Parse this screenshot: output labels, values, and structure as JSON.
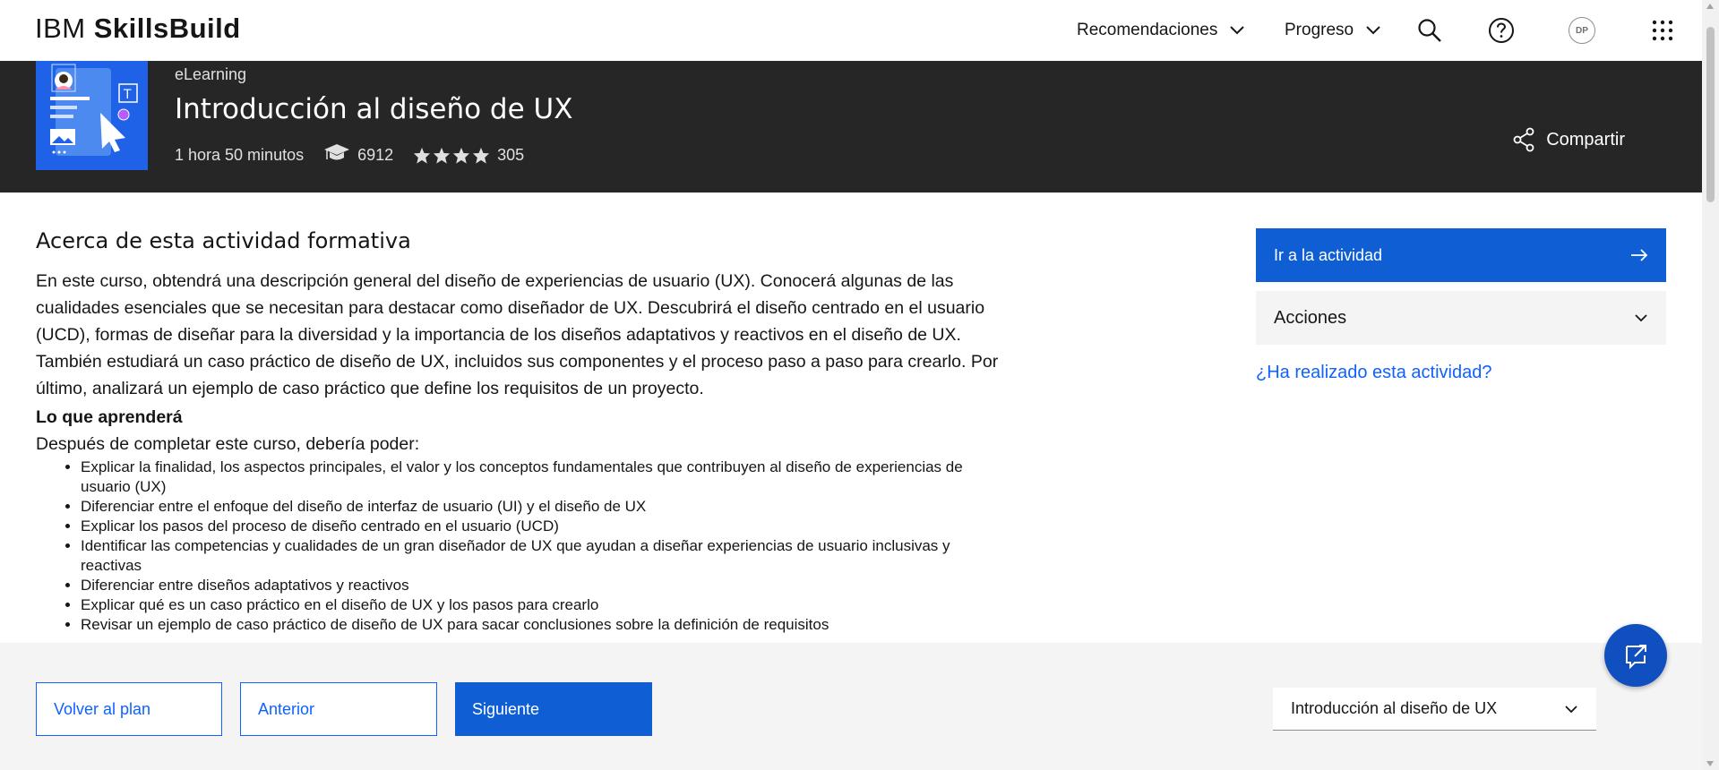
{
  "header": {
    "brand_light": "IBM ",
    "brand_bold": "SkillsBuild",
    "nav": [
      {
        "label": "Recomendaciones"
      },
      {
        "label": "Progreso"
      }
    ],
    "avatar_initials": "DP",
    "icons": [
      "search-icon",
      "help-icon",
      "app-switcher-icon"
    ]
  },
  "banner": {
    "kicker": "eLearning",
    "title": "Introducción al diseño de UX",
    "duration": "1 hora 50 minutos",
    "enrolled": "6912",
    "rating_count": "305",
    "rating_stars": 4,
    "share_label": "Compartir"
  },
  "about": {
    "title": "Acerca de esta actividad formativa",
    "description": "En este curso, obtendrá una descripción general del diseño de experiencias de usuario (UX). Conocerá algunas de las cualidades esenciales que se necesitan para destacar como diseñador de UX. Descubrirá el diseño centrado en el usuario (UCD), formas de diseñar para la diversidad y la importancia de los diseños adaptativos y reactivos en el diseño de UX. También estudiará un caso práctico de diseño de UX, incluidos sus componentes y el proceso paso a paso para crearlo. Por último, analizará un ejemplo de caso práctico que define los requisitos de un proyecto.",
    "learn_heading": "Lo que aprenderá",
    "learn_intro": "Después de completar este curso, debería poder:",
    "outcomes": [
      "Explicar la finalidad, los aspectos principales, el valor y los conceptos fundamentales que contribuyen al diseño de experiencias de usuario (UX)",
      "Diferenciar entre el enfoque del diseño de interfaz de usuario (UI) y el diseño de UX",
      "Explicar los pasos del proceso de diseño centrado en el usuario (UCD)",
      "Identificar las competencias y cualidades de un gran diseñador de UX que ayudan a diseñar experiencias de usuario inclusivas y reactivas",
      "Diferenciar entre diseños adaptativos y reactivos",
      "Explicar qué es un caso práctico en el diseño de UX y los pasos para crearlo",
      "Revisar un ejemplo de caso práctico de diseño de UX para sacar conclusiones sobre la definición de requisitos"
    ]
  },
  "sidebar": {
    "go_label": "Ir a la actividad",
    "actions_label": "Acciones",
    "done_link": "¿Ha realizado esta actividad?"
  },
  "footer": {
    "back_label": "Volver al plan",
    "prev_label": "Anterior",
    "next_label": "Siguiente",
    "select_value": "Introducción al diseño de UX"
  },
  "colors": {
    "primary": "#0f62fe",
    "banner_bg": "#262626",
    "footer_bg": "#f4f4f4"
  }
}
